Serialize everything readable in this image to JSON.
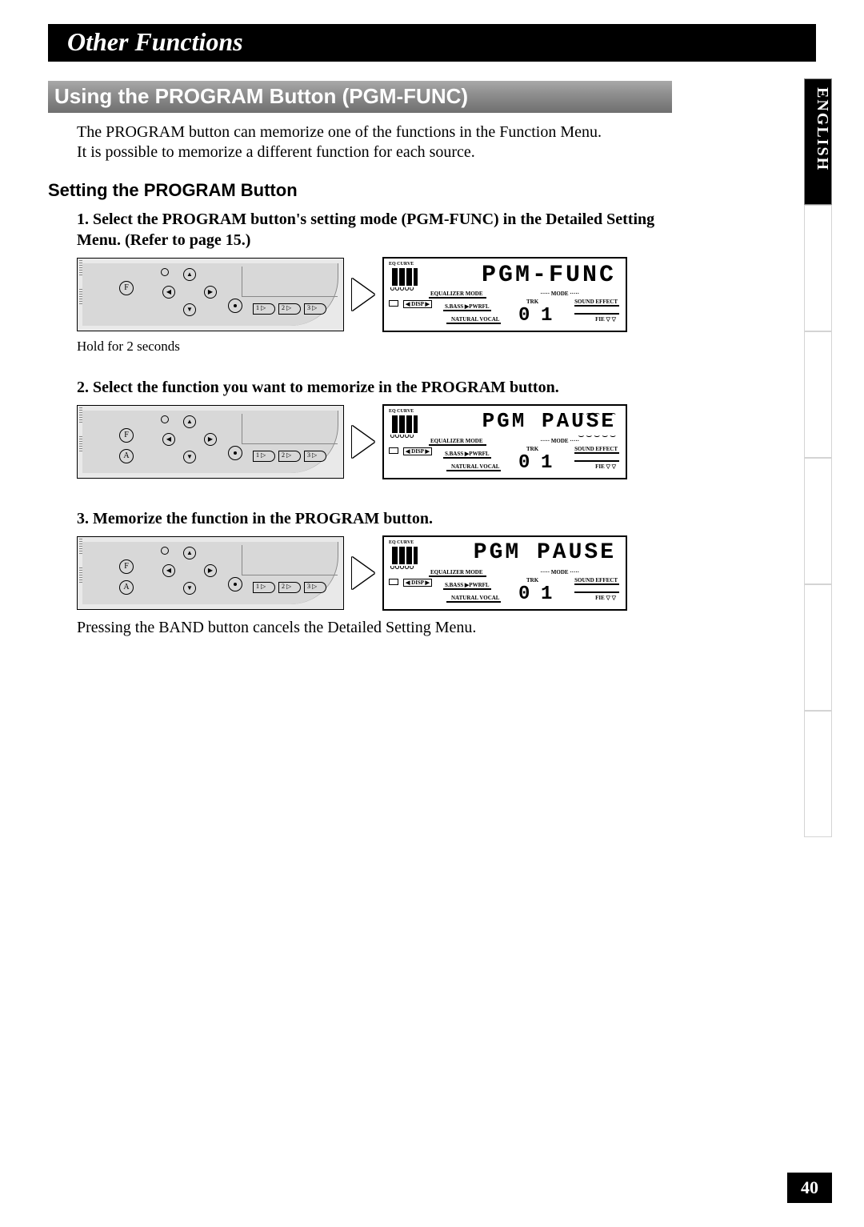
{
  "chapter": "Other Functions",
  "section": "Using the PROGRAM Button (PGM-FUNC)",
  "intro_line1": "The PROGRAM button can memorize one of the functions in the Function Menu.",
  "intro_line2": "It is possible to memorize a different function for each source.",
  "subhead": "Setting the PROGRAM Button",
  "language_tab": "ENGLISH",
  "page_number": "40",
  "steps": [
    {
      "num": "1.",
      "text": "Select the PROGRAM button's setting mode (PGM-FUNC) in the Detailed Setting Menu. (Refer to page 15.)",
      "caption": "Hold for 2 seconds",
      "lcd_main": "PGM-FUNC",
      "lcd_mid": "EQUALIZER MODE",
      "lcd_mode": "····· MODE ·····",
      "lcd_sbass": "S.BASS ▶PWRFL",
      "lcd_trk": "TRK",
      "lcd_se": "SOUND EFFECT",
      "lcd_nat": "NATURAL  VOCAL",
      "lcd_fie": "FIE  ▽ ▽",
      "lcd_eq": "EQ CURVE",
      "lcd_d1": "0",
      "lcd_d2": "1",
      "show_a_button": false
    },
    {
      "num": "2.",
      "text": "Select the function you want to memorize in the PROGRAM button.",
      "caption": "",
      "lcd_main": "PGM  PAUSE",
      "lcd_blink": true,
      "lcd_mid": "EQUALIZER MODE",
      "lcd_mode": "····· MODE ·····",
      "lcd_sbass": "S.BASS ▶PWRFL",
      "lcd_trk": "TRK",
      "lcd_se": "SOUND EFFECT",
      "lcd_nat": "NATURAL  VOCAL",
      "lcd_fie": "FIE  ▽ ▽",
      "lcd_eq": "EQ CURVE",
      "lcd_d1": "0",
      "lcd_d2": "1",
      "show_a_button": true
    },
    {
      "num": "3.",
      "text": "Memorize the function in the PROGRAM button.",
      "caption": "",
      "lcd_main": "PGM  PAUSE",
      "lcd_mid": "EQUALIZER MODE",
      "lcd_mode": "····· MODE ·····",
      "lcd_sbass": "S.BASS ▶PWRFL",
      "lcd_trk": "TRK",
      "lcd_se": "SOUND EFFECT",
      "lcd_nat": "NATURAL  VOCAL",
      "lcd_fie": "FIE  ▽ ▽",
      "lcd_eq": "EQ CURVE",
      "lcd_d1": "0",
      "lcd_d2": "1",
      "show_a_button": true
    }
  ],
  "footer_note": "Pressing the BAND button cancels the Detailed Setting Menu.",
  "faceplate": {
    "f": "F",
    "a": "A",
    "up": "▲",
    "dn": "▼",
    "lf": "◀",
    "rt": "▶",
    "n1": "1 ▷",
    "n2": "2 ▷",
    "n3": "3 ▷"
  }
}
